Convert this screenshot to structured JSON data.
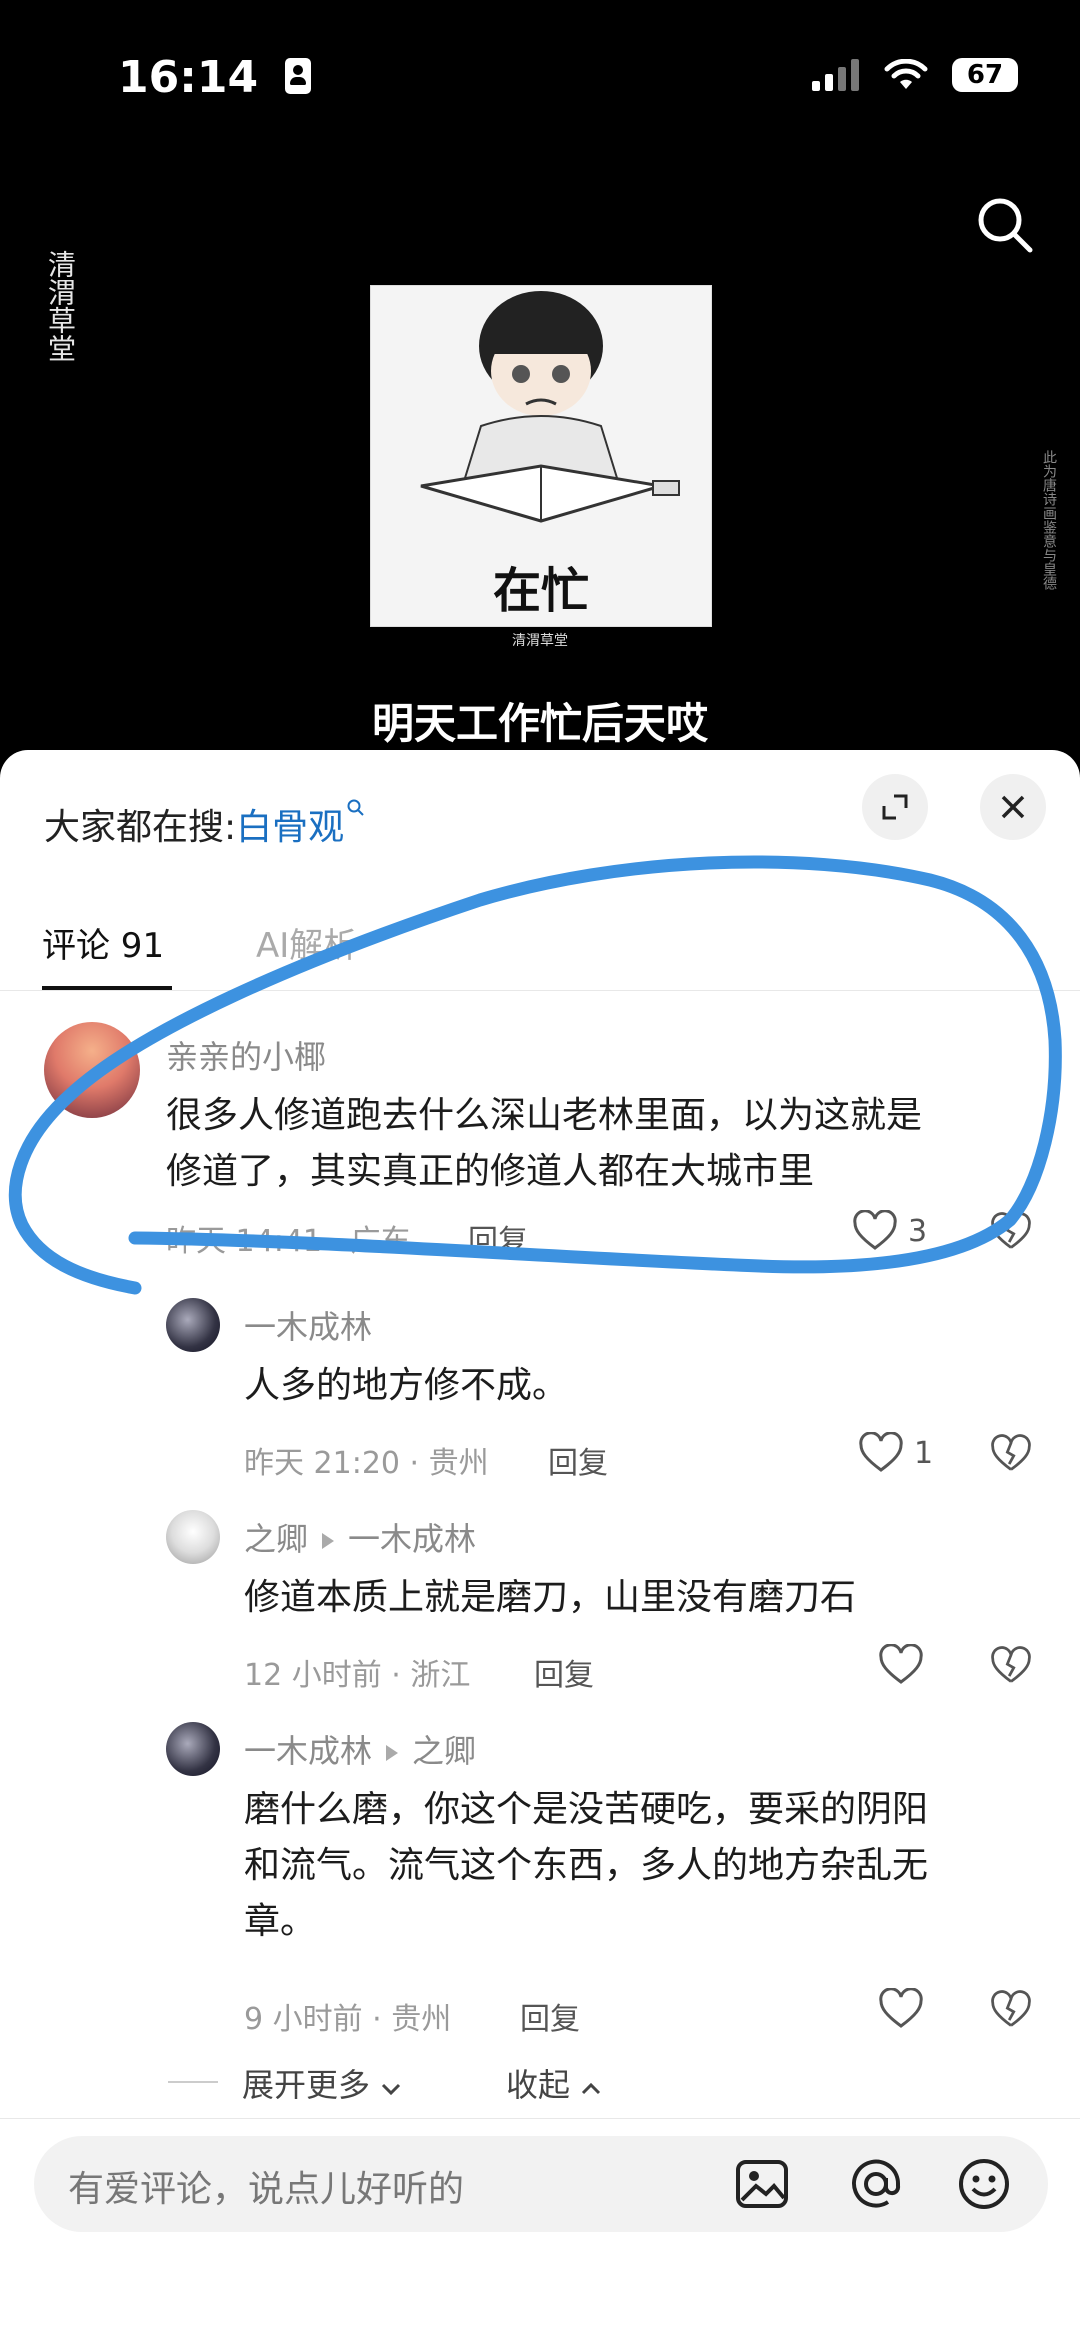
{
  "status": {
    "time": "16:14",
    "battery": "67"
  },
  "video": {
    "logo_text": "清渭草堂",
    "meme_text": "在忙",
    "meme_caption": "清渭草堂",
    "vertical_text": "此为唐诗画鉴意与皇德",
    "subtitle": "明天工作忙后天哎"
  },
  "sheet": {
    "search_prefix": "大家都在搜:",
    "search_term": "白骨观",
    "tabs": [
      {
        "label": "评论 91"
      },
      {
        "label": "AI解析"
      }
    ],
    "comments": [
      {
        "user": "亲亲的小椰",
        "line1": "很多人修道跑去什么深山老林里面，以为这就是",
        "line2": "修道了，其实真正的修道人都在大城市里",
        "meta": "昨天 14:41 · 广东",
        "reply": "回复",
        "likes": "3"
      },
      {
        "user": "一木成林",
        "text": "人多的地方修不成。",
        "meta": "昨天 21:20 · 贵州",
        "reply": "回复",
        "likes": "1"
      },
      {
        "user": "之卿",
        "reply_to": "一木成林",
        "text": "修道本质上就是磨刀，山里没有磨刀石",
        "meta": "12 小时前 · 浙江",
        "reply": "回复"
      },
      {
        "user": "一木成林",
        "reply_to": "之卿",
        "line1": "磨什么磨，你这个是没苦硬吃，要采的阴阳",
        "line2": "和流气。流气这个东西，多人的地方杂乱无",
        "line3": "章。",
        "meta": "9 小时前 · 贵州",
        "reply": "回复"
      }
    ],
    "expand_more": "展开更多",
    "collapse": "收起"
  },
  "input": {
    "placeholder": "有爱评论，说点儿好听的"
  },
  "colors": {
    "accent_blue": "#3d92e0",
    "link": "#1a6fc1"
  }
}
